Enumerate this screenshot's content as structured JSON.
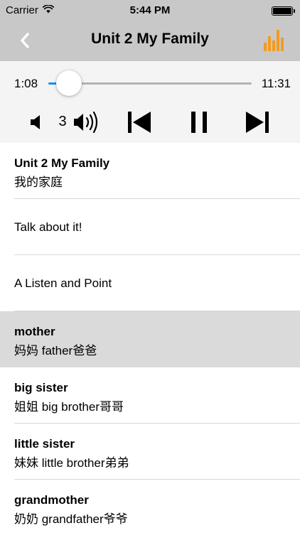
{
  "status_bar": {
    "carrier": "Carrier",
    "time": "5:44 PM",
    "battery_level": 1.0
  },
  "nav": {
    "title": "Unit 2 My Family",
    "back_icon": "chevron-left-icon",
    "right_icon": "equalizer-icon"
  },
  "colors": {
    "accent_orange": "#f39c1f",
    "progress_blue": "#1a8ff0",
    "bar_gray": "#c8c8c8",
    "selected_row": "#dadada"
  },
  "player": {
    "current_time": "1:08",
    "total_time": "11:31",
    "progress": 0.1,
    "volume_level": "3"
  },
  "list": {
    "items": [
      {
        "title": "Unit 2 My Family",
        "subtitle": "我的家庭"
      },
      {
        "text": "Talk about it!"
      },
      {
        "text": "A Listen and Point"
      },
      {
        "title": "mother",
        "subtitle": "妈妈 father爸爸",
        "selected": true
      },
      {
        "title": "big sister",
        "subtitle": "姐姐 big brother哥哥"
      },
      {
        "title": "little sister",
        "subtitle": "妹妹 little brother弟弟"
      },
      {
        "title": "grandmother",
        "subtitle": "奶奶 grandfather爷爷"
      }
    ]
  }
}
